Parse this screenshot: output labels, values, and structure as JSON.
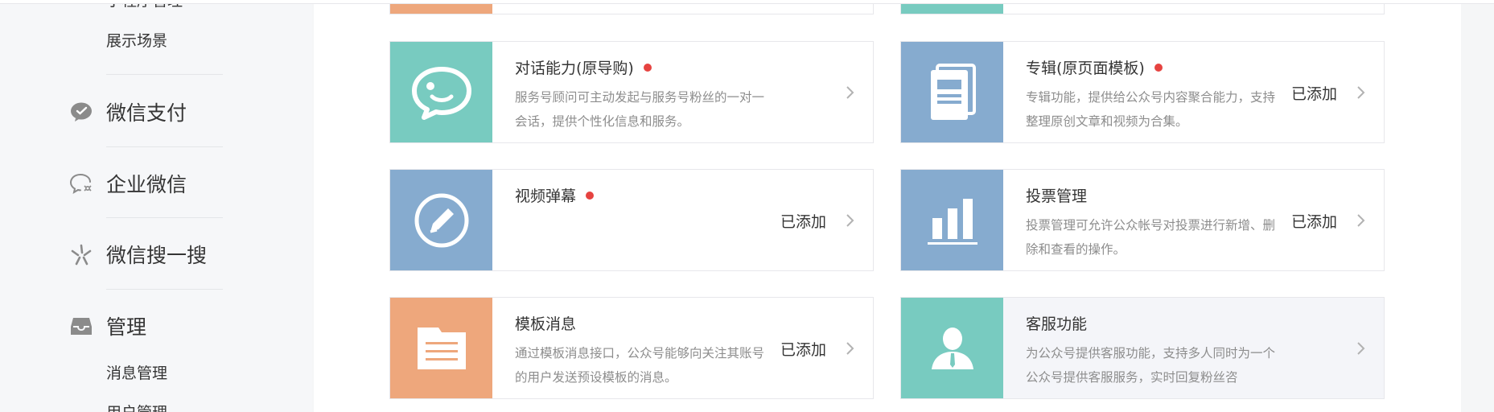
{
  "sidebar": {
    "cut_item": "小程序管理",
    "show_scene": "展示场景",
    "wechat_pay": "微信支付",
    "wework": "企业微信",
    "search": "微信搜一搜",
    "manage": "管理",
    "msg_manage": "消息管理",
    "user_manage": "用户管理"
  },
  "cards": [
    {
      "title": "对话能力(原导购)",
      "desc": "服务号顾问可主动发起与服务号粉丝的一对一会话，提供个性化信息和服务。",
      "status": "",
      "color": "#78cbc0"
    },
    {
      "title": "专辑(原页面模板)",
      "desc": "专辑功能，提供给公众号内容聚合能力，支持整理原创文章和视频为合集。",
      "status": "已添加",
      "color": "#86abcf"
    },
    {
      "title": "视频弹幕",
      "desc": "",
      "status": "已添加",
      "color": "#86abcf"
    },
    {
      "title": "投票管理",
      "desc": "投票管理可允许公众帐号对投票进行新增、删除和查看的操作。",
      "status": "已添加",
      "color": "#86abcf"
    },
    {
      "title": "模板消息",
      "desc": "通过模板消息接口，公众号能够向关注其账号的用户发送预设模板的消息。",
      "status": "已添加",
      "color": "#eea77c"
    },
    {
      "title": "客服功能",
      "desc": "为公众号提供客服功能，支持多人同时为一个公众号提供客服服务，实时回复粉丝咨",
      "status": "",
      "color": "#78cbc0"
    }
  ],
  "colors": {
    "accent_red": "#e64340",
    "teal": "#78cbc0",
    "blue": "#86abcf",
    "orange": "#eea77c"
  },
  "icons": [
    "wechat-pay-icon",
    "wework-icon",
    "search-sparkle-icon",
    "inbox-icon",
    "chat-bubble-icon",
    "album-icon",
    "edit-circle-icon",
    "bar-chart-icon",
    "document-icon",
    "customer-service-icon",
    "chevron-right-icon"
  ]
}
